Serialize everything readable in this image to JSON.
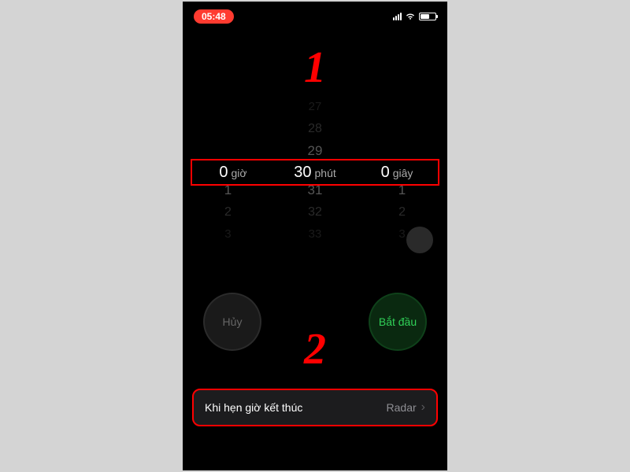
{
  "status": {
    "time": "05:48"
  },
  "callouts": {
    "one": "1",
    "two": "2"
  },
  "picker": {
    "hours": {
      "value": "0",
      "label": "giờ",
      "below": [
        "1",
        "2",
        "3"
      ]
    },
    "minutes": {
      "value": "30",
      "label": "phút",
      "above": [
        "27",
        "28",
        "29"
      ],
      "below": [
        "31",
        "32",
        "33"
      ]
    },
    "seconds": {
      "value": "0",
      "label": "giây",
      "below": [
        "1",
        "2",
        "3"
      ]
    }
  },
  "buttons": {
    "cancel": "Hủy",
    "start": "Bắt đầu"
  },
  "endRow": {
    "label": "Khi hẹn giờ kết thúc",
    "value": "Radar"
  }
}
